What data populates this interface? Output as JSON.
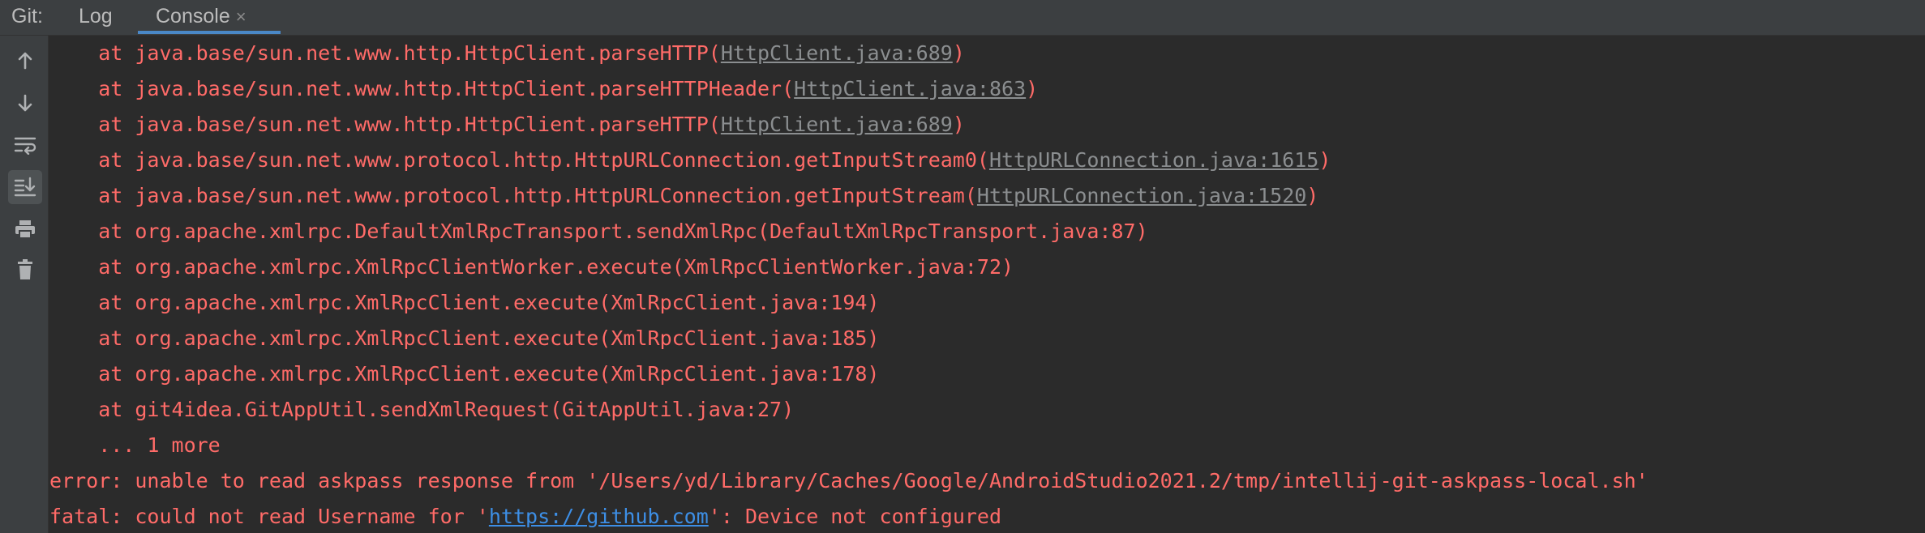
{
  "header": {
    "git_label": "Git:",
    "tabs": [
      {
        "label": "Log"
      },
      {
        "label": "Console",
        "close_glyph": "×"
      }
    ]
  },
  "toolbar": {
    "icons": [
      "up-arrow-icon",
      "down-arrow-icon",
      "soft-wrap-icon",
      "scroll-to-end-icon",
      "print-icon",
      "trash-icon"
    ]
  },
  "colors": {
    "error_text": "#ff6b68",
    "link_gray": "#8b8e90",
    "url_blue": "#3d8fe6",
    "tab_underline": "#4a88c7"
  },
  "console": {
    "lines": [
      {
        "pre": "    at java.base/sun.net.www.http.HttpClient.parseHTTP(",
        "link": "HttpClient.java:689",
        "post": ")"
      },
      {
        "pre": "    at java.base/sun.net.www.http.HttpClient.parseHTTPHeader(",
        "link": "HttpClient.java:863",
        "post": ")"
      },
      {
        "pre": "    at java.base/sun.net.www.http.HttpClient.parseHTTP(",
        "link": "HttpClient.java:689",
        "post": ")"
      },
      {
        "pre": "    at java.base/sun.net.www.protocol.http.HttpURLConnection.getInputStream0(",
        "link": "HttpURLConnection.java:1615",
        "post": ")"
      },
      {
        "pre": "    at java.base/sun.net.www.protocol.http.HttpURLConnection.getInputStream(",
        "link": "HttpURLConnection.java:1520",
        "post": ")"
      },
      {
        "pre": "    at org.apache.xmlrpc.DefaultXmlRpcTransport.sendXmlRpc(DefaultXmlRpcTransport.java:87)",
        "link": "",
        "post": ""
      },
      {
        "pre": "    at org.apache.xmlrpc.XmlRpcClientWorker.execute(XmlRpcClientWorker.java:72)",
        "link": "",
        "post": ""
      },
      {
        "pre": "    at org.apache.xmlrpc.XmlRpcClient.execute(XmlRpcClient.java:194)",
        "link": "",
        "post": ""
      },
      {
        "pre": "    at org.apache.xmlrpc.XmlRpcClient.execute(XmlRpcClient.java:185)",
        "link": "",
        "post": ""
      },
      {
        "pre": "    at org.apache.xmlrpc.XmlRpcClient.execute(XmlRpcClient.java:178)",
        "link": "",
        "post": ""
      },
      {
        "pre": "    at git4idea.GitAppUtil.sendXmlRequest(GitAppUtil.java:27)",
        "link": "",
        "post": ""
      },
      {
        "pre": "    ... 1 more",
        "link": "",
        "post": ""
      },
      {
        "pre": "error: unable to read askpass response from '/Users/yd/Library/Caches/Google/AndroidStudio2021.2/tmp/intellij-git-askpass-local.sh'",
        "link": "",
        "post": ""
      },
      {
        "pre": "fatal: could not read Username for '",
        "url": "https://github.com",
        "post": "': Device not configured"
      }
    ]
  }
}
